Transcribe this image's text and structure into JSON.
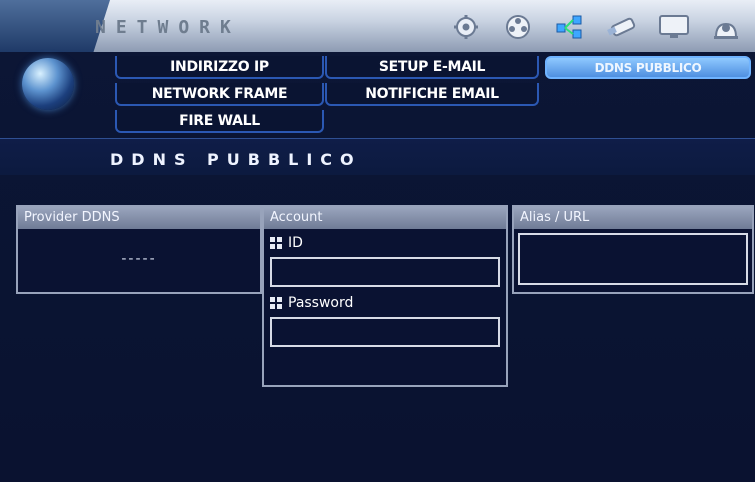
{
  "header": {
    "title": "NETWORK",
    "toolbar": [
      "settings-gear-icon",
      "film-reel-icon",
      "network-nodes-icon",
      "usb-drive-icon",
      "monitor-icon",
      "user-lock-icon"
    ]
  },
  "tabs": [
    {
      "label": "INDIRIZZO IP"
    },
    {
      "label": "SETUP E-MAIL"
    },
    {
      "label": "DDNS PUBBLICO",
      "active": true
    },
    {
      "label": "NETWORK FRAME"
    },
    {
      "label": "NOTIFICHE EMAIL"
    },
    {
      "label": "FIRE WALL"
    }
  ],
  "section": {
    "title": "DDNS PUBBLICO"
  },
  "panels": {
    "provider": {
      "header": "Provider DDNS",
      "value": "-----"
    },
    "account": {
      "header": "Account",
      "id_label": "ID",
      "password_label": "Password",
      "id_value": "",
      "password_value": ""
    },
    "alias": {
      "header": "Alias / URL",
      "value": ""
    }
  },
  "colors": {
    "accent": "#2b58b3",
    "active_tab": "#6fb3ff",
    "background": "#0a1432"
  }
}
